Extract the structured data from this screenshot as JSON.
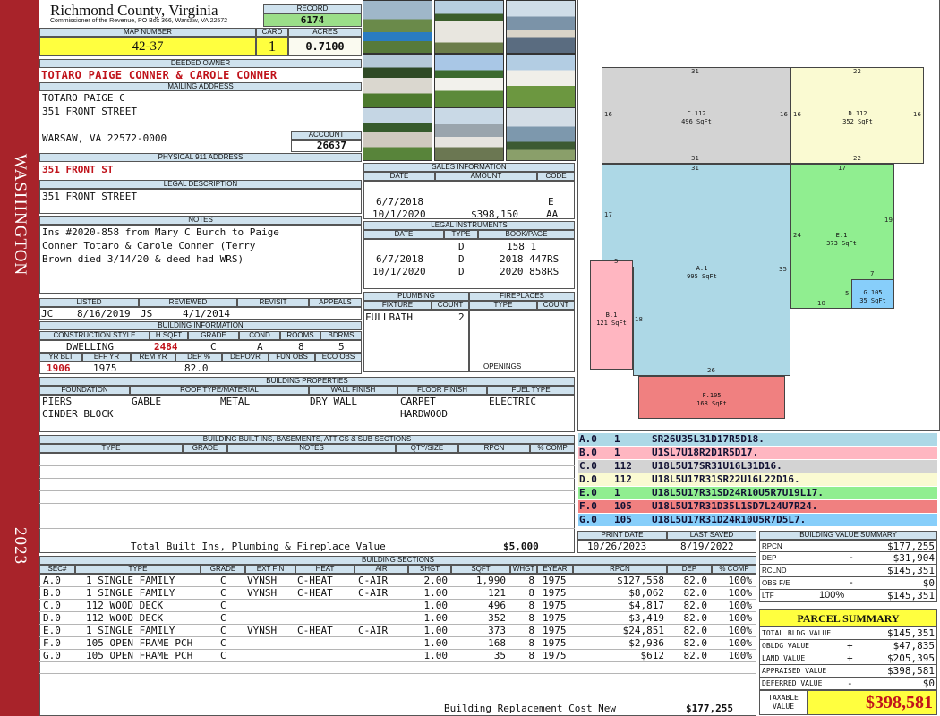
{
  "sidebar": {
    "county": "WASHINGTON",
    "year": "2023"
  },
  "header": {
    "county": "Richmond County, Virginia",
    "commissioner": "Commissioner of the Revenue, PO Box 366, Warsaw, VA 22572"
  },
  "record": {
    "label": "RECORD",
    "value": "6174"
  },
  "map": {
    "label": "MAP NUMBER",
    "value": "42-37"
  },
  "card": {
    "label": "CARD",
    "value": "1"
  },
  "acres": {
    "label": "ACRES",
    "value": "0.7100"
  },
  "owner": {
    "label": "DEEDED OWNER",
    "value": "TOTARO PAIGE CONNER & CAROLE CONNER"
  },
  "mailing": {
    "label": "MAILING ADDRESS",
    "line1": "TOTARO PAIGE C",
    "line2": "351 FRONT STREET",
    "line3": "WARSAW, VA 22572-0000"
  },
  "account": {
    "label": "ACCOUNT",
    "value": "26637"
  },
  "physical": {
    "label": "PHYSICAL 911 ADDRESS",
    "value": "351 FRONT ST"
  },
  "legal": {
    "label": "LEGAL DESCRIPTION",
    "value": "351 FRONT STREET"
  },
  "notes": {
    "label": "NOTES",
    "line1": "Ins #2020-858 from Mary C Burch to Paige",
    "line2": "Conner Totaro & Carole Conner (Terry",
    "line3": "Brown died 3/14/20 & deed had WRS)"
  },
  "sales": {
    "label": "SALES INFORMATION",
    "headers": [
      "DATE",
      "AMOUNT",
      "CODE"
    ],
    "rows": [
      [
        "6/7/2018",
        "",
        "E"
      ],
      [
        "10/1/2020",
        "$398,150",
        "AA"
      ]
    ]
  },
  "instruments": {
    "label": "LEGAL INSTRUMENTS",
    "headers": [
      "DATE",
      "TYPE",
      "BOOK/PAGE"
    ],
    "rows": [
      [
        "",
        "D",
        "158 1"
      ],
      [
        "6/7/2018",
        "D",
        "2018 447RS"
      ],
      [
        "10/1/2020",
        "D",
        "2020 858RS"
      ]
    ]
  },
  "listed": {
    "listed_label": "LISTED",
    "reviewed_label": "REVIEWED",
    "revisit_label": "REVISIT",
    "appeals_label": "APPEALS",
    "lister": "JC",
    "listed_date": "8/16/2019",
    "reviewer": "JS",
    "reviewed_date": "4/1/2014"
  },
  "plumbing": {
    "label": "PLUMBING",
    "h1": "FIXTURE",
    "h2": "COUNT",
    "fixture": "FULLBATH",
    "count": "2"
  },
  "fireplaces": {
    "label": "FIREPLACES",
    "h1": "TYPE",
    "h2": "COUNT",
    "openings": "OPENINGS"
  },
  "building_info": {
    "label": "BUILDING INFORMATION",
    "h": [
      "CONSTRUCTION STYLE",
      "H SQFT",
      "GRADE",
      "COND",
      "ROOMS",
      "BDRMS"
    ],
    "v": [
      "DWELLING",
      "2484",
      "C",
      "A",
      "8",
      "5"
    ],
    "h2": [
      "YR BLT",
      "EFF YR",
      "REM YR",
      "DEP %",
      "DEPOVR",
      "FUN OBS",
      "ECO OBS"
    ],
    "v2": [
      "1906",
      "1975",
      "",
      "82.0",
      "",
      "",
      ""
    ]
  },
  "properties": {
    "label": "BUILDING PROPERTIES",
    "h": [
      "FOUNDATION",
      "ROOF TYPE/MATERIAL",
      "WALL FINISH",
      "FLOOR FINISH",
      "FUEL TYPE"
    ],
    "foundation1": "PIERS",
    "foundation2": "CINDER BLOCK",
    "roof1": "GABLE",
    "roof2": "METAL",
    "wall": "DRY WALL",
    "floor1": "CARPET",
    "floor2": "HARDWOOD",
    "fuel": "ELECTRIC"
  },
  "builtins": {
    "label": "BUILDING BUILT INS, BASEMENTS, ATTICS & SUB SECTIONS",
    "h": [
      "TYPE",
      "GRADE",
      "NOTES",
      "QTY/SIZE",
      "RPCN",
      "% COMP"
    ],
    "total_label": "Total Built Ins, Plumbing & Fireplace Value",
    "total": "$5,000"
  },
  "dates": {
    "print_label": "PRINT DATE",
    "saved_label": "LAST SAVED",
    "print": "10/26/2023",
    "saved": "8/19/2022"
  },
  "sections": {
    "label": "BUILDING SECTIONS",
    "h": [
      "SEC#",
      "TYPE",
      "GRADE",
      "EXT FIN",
      "HEAT",
      "AIR",
      "SHGT",
      "SQFT",
      "WHGT",
      "EYEAR",
      "RPCN",
      "DEP",
      "% COMP"
    ],
    "rows": [
      [
        "A.0",
        "1 SINGLE FAMILY",
        "C",
        "VYNSH",
        "C-HEAT",
        "C-AIR",
        "2.00",
        "1,990",
        "8",
        "1975",
        "$127,558",
        "82.0",
        "100%"
      ],
      [
        "B.0",
        "1 SINGLE FAMILY",
        "C",
        "VYNSH",
        "C-HEAT",
        "C-AIR",
        "1.00",
        "121",
        "8",
        "1975",
        "$8,062",
        "82.0",
        "100%"
      ],
      [
        "C.0",
        "112 WOOD DECK",
        "C",
        "",
        "",
        "",
        "1.00",
        "496",
        "8",
        "1975",
        "$4,817",
        "82.0",
        "100%"
      ],
      [
        "D.0",
        "112 WOOD DECK",
        "C",
        "",
        "",
        "",
        "1.00",
        "352",
        "8",
        "1975",
        "$3,419",
        "82.0",
        "100%"
      ],
      [
        "E.0",
        "1 SINGLE FAMILY",
        "C",
        "VYNSH",
        "C-HEAT",
        "C-AIR",
        "1.00",
        "373",
        "8",
        "1975",
        "$24,851",
        "82.0",
        "100%"
      ],
      [
        "F.0",
        "105 OPEN FRAME PCH",
        "C",
        "",
        "",
        "",
        "1.00",
        "168",
        "8",
        "1975",
        "$2,936",
        "82.0",
        "100%"
      ],
      [
        "G.0",
        "105 OPEN FRAME PCH",
        "C",
        "",
        "",
        "",
        "1.00",
        "35",
        "8",
        "1975",
        "$612",
        "82.0",
        "100%"
      ]
    ],
    "total_label": "Building Replacement Cost New",
    "total": "$177,255"
  },
  "segments": [
    {
      "sec": "A.0",
      "code": "1",
      "path": "SR26U35L31D17R5D18.",
      "color": "#add8e6"
    },
    {
      "sec": "B.0",
      "code": "1",
      "path": "U1SL7U18R2D1R5D17.",
      "color": "#ffb6c1"
    },
    {
      "sec": "C.0",
      "code": "112",
      "path": "U18L5U17SR31U16L31D16.",
      "color": "#d3d3d3"
    },
    {
      "sec": "D.0",
      "code": "112",
      "path": "U18L5U17R31SR22U16L22D16.",
      "color": "#fafad2"
    },
    {
      "sec": "E.0",
      "code": "1",
      "path": "U18L5U17R31SD24R10U5R7U19L17.",
      "color": "#90ee90"
    },
    {
      "sec": "F.0",
      "code": "105",
      "path": "U18L5U17R31D35L1SD7L24U7R24.",
      "color": "#f08080"
    },
    {
      "sec": "G.0",
      "code": "105",
      "path": "U18L5U17R31D24R10U5R7D5L7.",
      "color": "#87cefa"
    }
  ],
  "sketch": {
    "C": {
      "name": "C.112",
      "area": "496 SqFt"
    },
    "D": {
      "name": "D.112",
      "area": "352 SqFt"
    },
    "A": {
      "name": "A.1",
      "area": "995 SqFt"
    },
    "E": {
      "name": "E.1",
      "area": "373 SqFt"
    },
    "B": {
      "name": "B.1",
      "area": "121 SqFt"
    },
    "G": {
      "name": "G.105",
      "area": "35 SqFt"
    },
    "F": {
      "name": "F.105",
      "area": "168 SqFt"
    },
    "dims": {
      "c_top": "31",
      "c_left": "16",
      "c_right": "16",
      "c_bot": "31",
      "d_top": "22",
      "d_left": "16",
      "d_right": "16",
      "d_bot": "22",
      "a_top": "31",
      "a_left": "17",
      "a_right": "35",
      "a_bot": "26",
      "a_step": "5",
      "b_side": "18",
      "e_top": "17",
      "e_left": "24",
      "e_right": "19",
      "e_bot": "10",
      "g_top": "7",
      "g_left": "5"
    }
  },
  "bvs": {
    "label": "BUILDING VALUE SUMMARY",
    "rpcn_k": "RPCN",
    "rpcn": "$177,255",
    "dep_k": "DEP",
    "dep_s": "-",
    "dep": "$31,904",
    "rclnd_k": "RCLND",
    "rclnd": "$145,351",
    "obs_k": "OBS F/E",
    "obs_s": "-",
    "obs": "$0",
    "ltf_k": "LTF",
    "ltf_pct": "100%",
    "ltf": "$145,351"
  },
  "parcel": {
    "title": "PARCEL SUMMARY",
    "bldg_k": "TOTAL BLDG VALUE",
    "bldg": "$145,351",
    "obldg_k": "OBLDG VALUE",
    "obldg_s": "+",
    "obldg": "$47,835",
    "land_k": "LAND VALUE",
    "land_s": "+",
    "land": "$205,395",
    "appr_k": "APPRAISED VALUE",
    "appr": "$398,581",
    "def_k": "DEFERRED VALUE",
    "def_s": "-",
    "def": "$0",
    "tax_k1": "TAXABLE",
    "tax_k2": "VALUE",
    "tax": "$398,581"
  }
}
